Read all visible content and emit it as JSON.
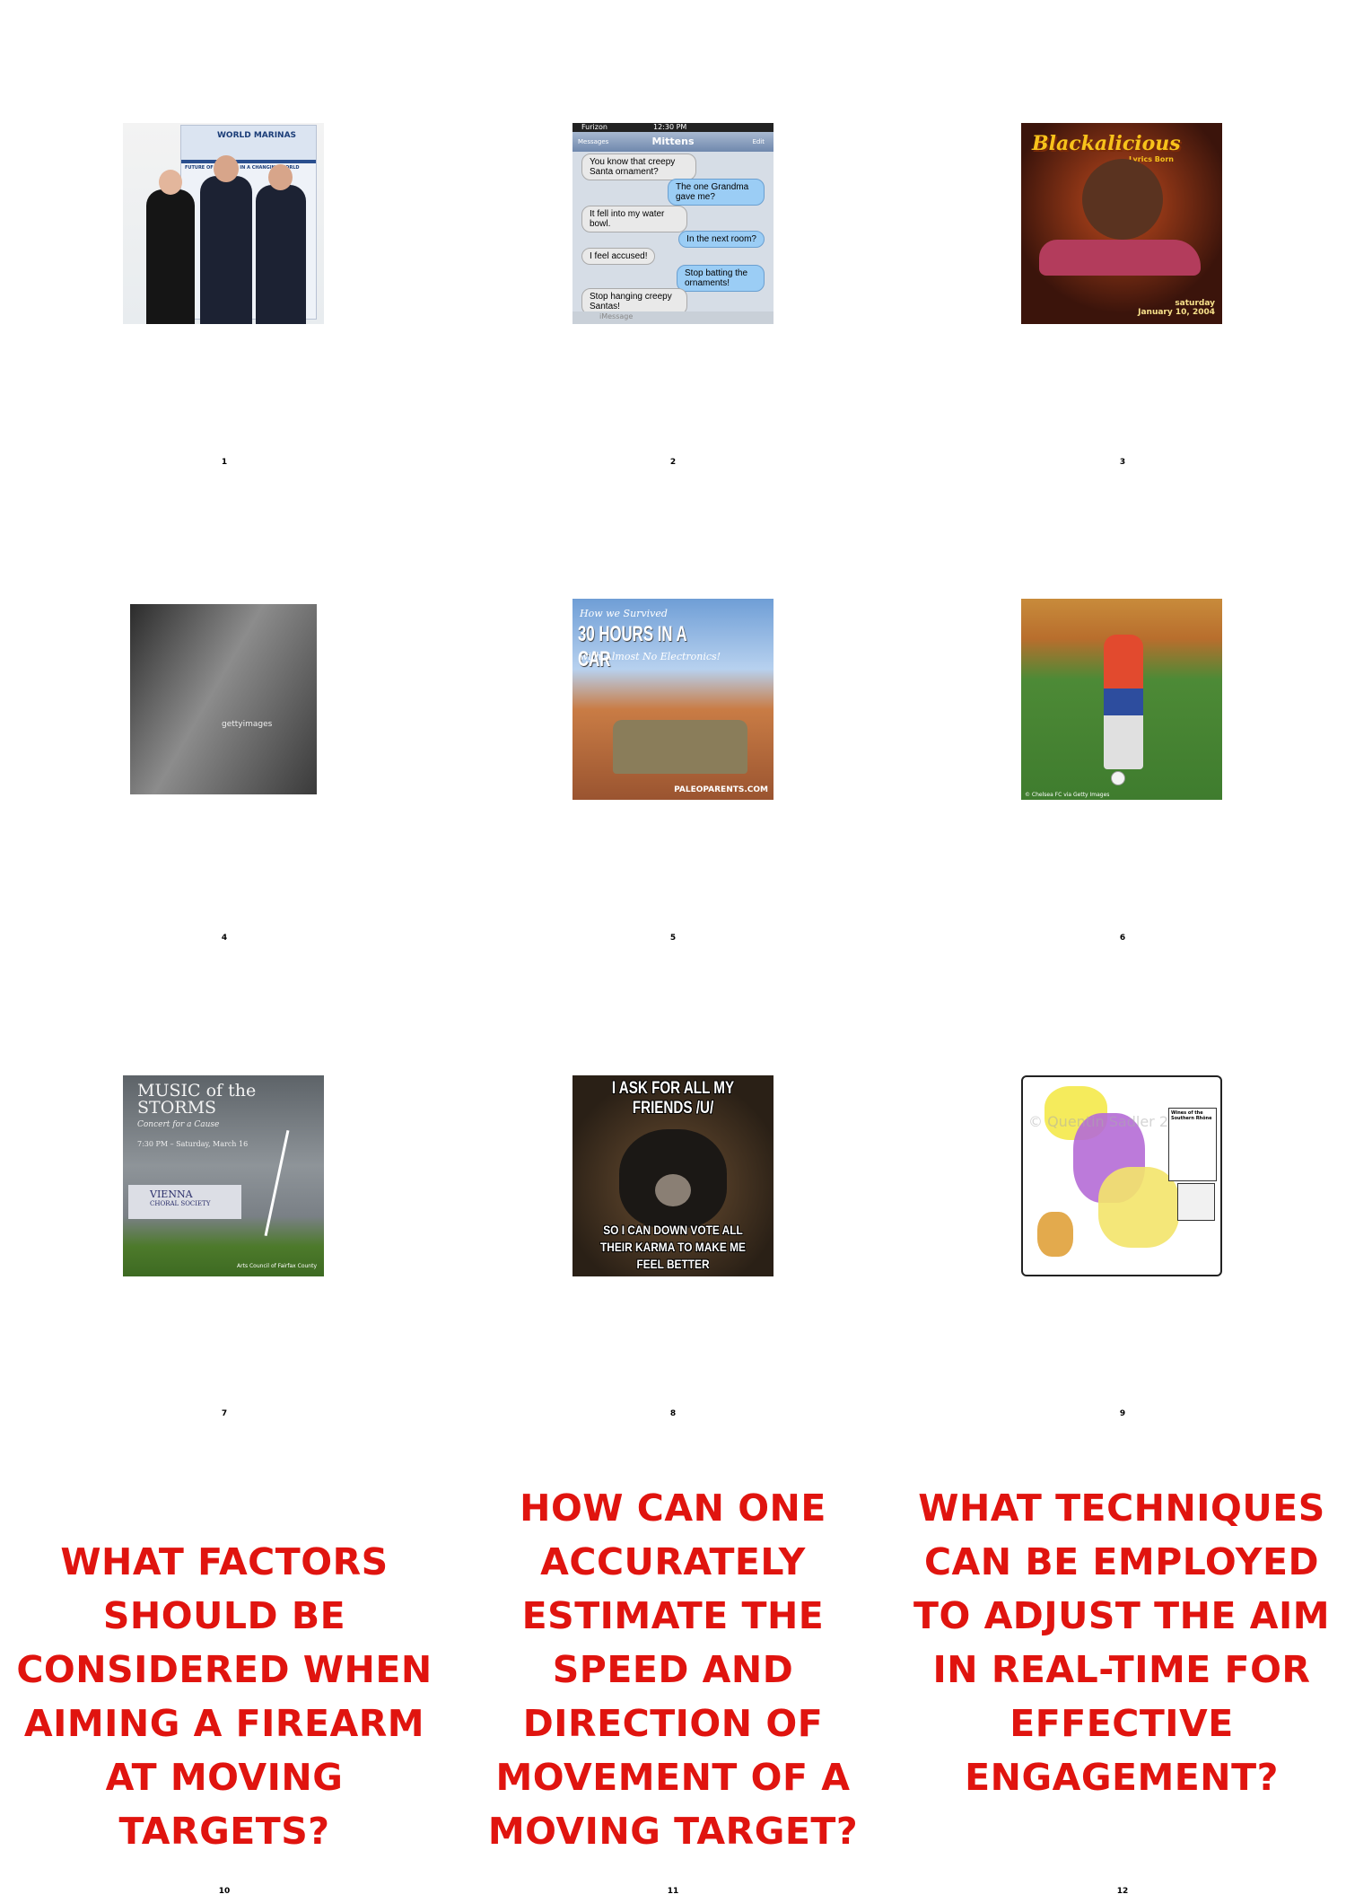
{
  "numbers": [
    "1",
    "2",
    "3",
    "4",
    "5",
    "6",
    "7",
    "8",
    "9",
    "10",
    "11",
    "12"
  ],
  "images": {
    "img1": {
      "banner_line1": "WORLD MARINAS",
      "banner_line2": "FUTURE OF MARINAS IN A CHANGING WORLD"
    },
    "img2": {
      "carrier": "Furizon",
      "time": "12:30 PM",
      "back": "Messages",
      "contact": "Mittens",
      "edit": "Edit",
      "messages": [
        "You know that creepy Santa ornament?",
        "The one Grandma gave me?",
        "It fell into my water bowl.",
        "In the next room?",
        "I feel accused!",
        "Stop batting the ornaments!",
        "Stop hanging creepy Santas!"
      ],
      "input_placeholder": "iMessage"
    },
    "img3": {
      "title": "Blackalicious",
      "subtitle": "Lyrics Born",
      "date_line1": "saturday",
      "date_line2": "January 10, 2004"
    },
    "img4": {
      "watermark": "gettyimages"
    },
    "img5": {
      "line1": "How we Survived",
      "line2": "30 HOURS IN A CAR",
      "line3": "with Almost No Electronics!",
      "watermark": "PALEOPARENTS.COM"
    },
    "img6": {
      "caption": "© Chelsea FC via Getty Images"
    },
    "img7": {
      "title_line1": "MUSIC of the",
      "title_line2": "STORMS",
      "subtitle": "Concert for a Cause",
      "datetime": "7:30 PM – Saturday, March 16",
      "org_line1": "VIENNA",
      "org_line2": "CHORAL SOCIETY",
      "footer": "Arts Council of Fairfax County"
    },
    "img8": {
      "top_text": "I ASK FOR ALL MY FRIENDS /U/",
      "bottom_text": "SO I CAN DOWN VOTE ALL THEIR KARMA TO MAKE ME FEEL BETTER"
    },
    "img9": {
      "legend_title": "Wines of the Southern Rhône",
      "watermark": "© Quentin Sadler 2014"
    }
  },
  "questions": {
    "q10": "What factors should be considered when aiming a firearm at moving targets?",
    "q11": "How can one accurately estimate the speed and direction of movement of a moving target?",
    "q12": "What techniques can be employed to adjust the aim in real-time for effective engagement?"
  },
  "colors": {
    "question_text": "#e0140f",
    "background": "#ffffff"
  }
}
